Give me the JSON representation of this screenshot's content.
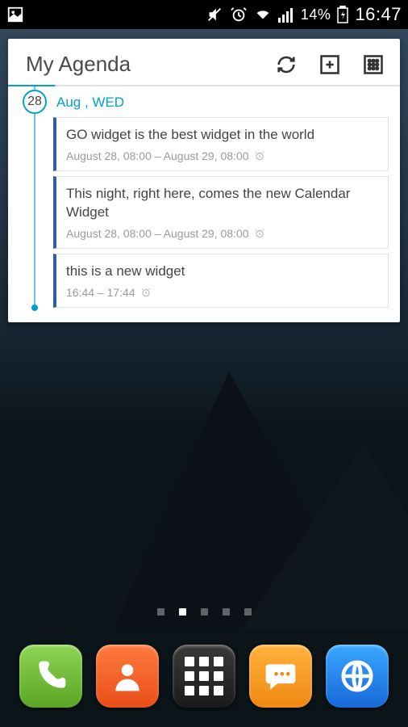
{
  "statusbar": {
    "battery_pct": "14%",
    "clock": "16:47"
  },
  "widget": {
    "title": "My Agenda",
    "date_number": "28",
    "date_label": "Aug , WED",
    "events": [
      {
        "title": "GO widget is the best widget in the world",
        "time": "August 28, 08:00 – August 29, 08:00"
      },
      {
        "title": "This night, right here, comes the new Calendar Widget",
        "time": "August 28, 08:00 – August 29, 08:00"
      },
      {
        "title": "this is a new widget",
        "time": "16:44 – 17:44"
      }
    ]
  },
  "pager": {
    "count": 5,
    "active": 1
  },
  "dock": {
    "items": [
      "phone",
      "contacts",
      "app-drawer",
      "messages",
      "browser"
    ]
  }
}
